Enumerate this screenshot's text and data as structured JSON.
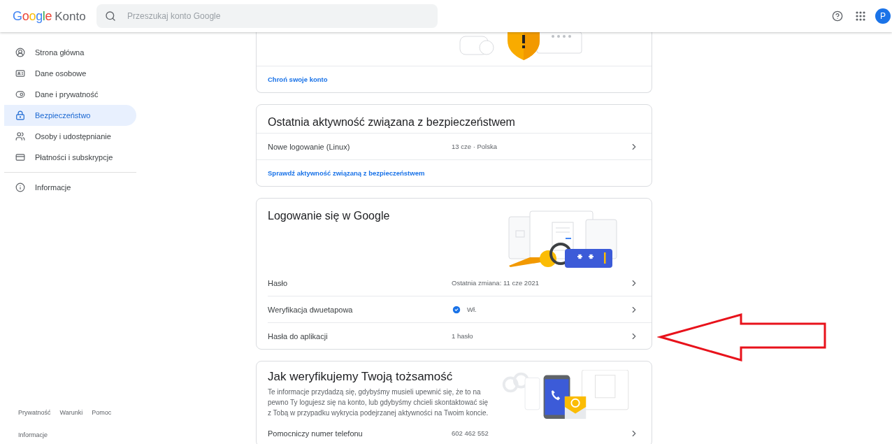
{
  "header": {
    "logo_brand": "Google",
    "logo_product": "Konto",
    "search": {
      "placeholder": "Przeszukaj konto Google"
    },
    "avatar_letter": "P"
  },
  "sidebar": {
    "items": [
      {
        "label": "Strona główna",
        "selected": false
      },
      {
        "label": "Dane osobowe",
        "selected": false
      },
      {
        "label": "Dane i prywatność",
        "selected": false
      },
      {
        "label": "Bezpieczeństwo",
        "selected": true
      },
      {
        "label": "Osoby i udostępnianie",
        "selected": false
      },
      {
        "label": "Płatności i subskrypcje",
        "selected": false
      }
    ],
    "info_item": {
      "label": "Informacje",
      "selected": false
    },
    "footer_links": [
      "Prywatność",
      "Warunki",
      "Pomoc"
    ],
    "footer_about": "Informacje"
  },
  "cards": [
    {
      "kind": "protect",
      "link": "Chroń swoje konto"
    },
    {
      "kind": "activity",
      "title": "Ostatnia aktywność związana z bezpieczeństwem",
      "rows": [
        {
          "label": "Nowe logowanie (Linux)",
          "value": "13 cze · Polska",
          "verified": false
        }
      ],
      "link": "Sprawdź aktywność związaną z bezpieczeństwem"
    },
    {
      "kind": "signin",
      "title": "Logowanie się w Google",
      "rows": [
        {
          "label": "Hasło",
          "value": "Ostatnia zmiana: 11 cze 2021",
          "verified": false
        },
        {
          "label": "Weryfikacja dwuetapowa",
          "value": "Wł.",
          "verified": true
        },
        {
          "label": "Hasła do aplikacji",
          "value": "1 hasło",
          "verified": false
        }
      ]
    },
    {
      "kind": "identity",
      "title": "Jak weryfikujemy Twoją tożsamość",
      "description": "Te informacje przydadzą się, gdybyśmy musieli upewnić się, że to na pewno Ty logujesz się na konto, lub gdybyśmy chcieli skontaktować się z Tobą w przypadku wykrycia podejrzanej aktywności na Twoim koncie.",
      "rows": [
        {
          "label": "Pomocniczy numer telefonu",
          "value": "602 462 552",
          "verified": false
        }
      ]
    }
  ]
}
